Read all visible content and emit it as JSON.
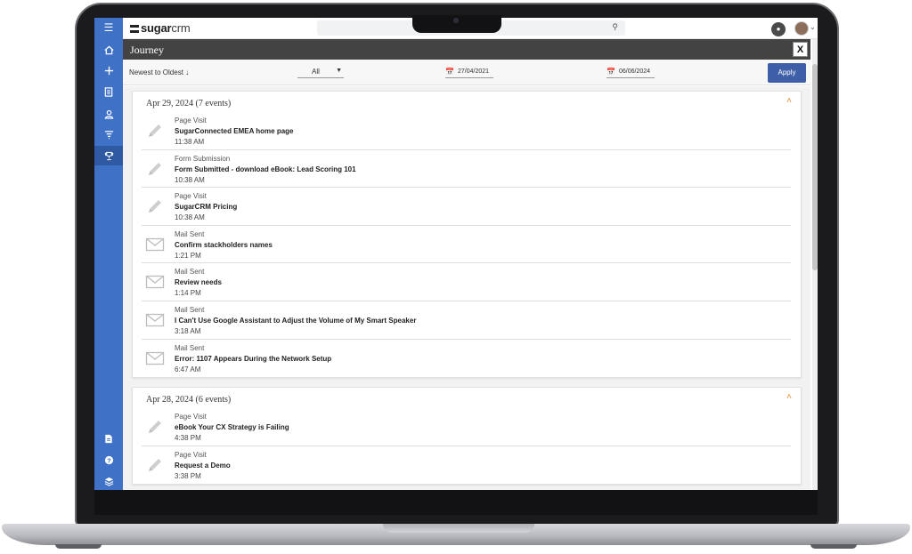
{
  "header": {
    "logo_bold": "sugar",
    "logo_light": "crm"
  },
  "dashlet": {
    "title": "Journey",
    "close_label": "X"
  },
  "filters": {
    "sort_label": "Newest to Oldest ↓",
    "type_value": "All",
    "date_from": "27/04/2021",
    "date_to": "06/06/2024",
    "apply_label": "Apply"
  },
  "sidebar": {
    "items": [
      "menu-icon",
      "home-icon",
      "plus-icon",
      "document-icon",
      "user-icon",
      "filter-icon",
      "trophy-icon"
    ],
    "bottom_items": [
      "file-icon",
      "help-icon",
      "stack-icon"
    ]
  },
  "groups": [
    {
      "title": "Apr 29, 2024 (7 events)",
      "events": [
        {
          "type": "Page Visit",
          "title": "SugarConnected EMEA home page",
          "time": "11:38 AM",
          "icon": "pencil-icon"
        },
        {
          "type": "Form Submission",
          "title": "Form Submitted - download eBook: Lead Scoring 101",
          "time": "10:38 AM",
          "icon": "pencil-icon"
        },
        {
          "type": "Page Visit",
          "title": "SugarCRM Pricing",
          "time": "10:38 AM",
          "icon": "pencil-icon"
        },
        {
          "type": "Mail Sent",
          "title": "Confirm stackholders names",
          "time": "1:21 PM",
          "icon": "mail-icon"
        },
        {
          "type": "Mail Sent",
          "title": "Review needs",
          "time": "1:14 PM",
          "icon": "mail-icon"
        },
        {
          "type": "Mail Sent",
          "title": "I Can't Use Google Assistant to Adjust the Volume of My Smart Speaker",
          "time": "3:18 AM",
          "icon": "mail-icon"
        },
        {
          "type": "Mail Sent",
          "title": "Error: 1107 Appears During the Network Setup",
          "time": "6:47 AM",
          "icon": "mail-icon"
        }
      ]
    },
    {
      "title": "Apr 28, 2024 (6 events)",
      "events": [
        {
          "type": "Page Visit",
          "title": "eBook Your CX Strategy is Failing",
          "time": "4:38 PM",
          "icon": "pencil-icon"
        },
        {
          "type": "Page Visit",
          "title": "Request a Demo",
          "time": "3:38 PM",
          "icon": "pencil-icon"
        }
      ]
    }
  ],
  "colors": {
    "sidebar": "#3f72c7",
    "title_bar": "#434343",
    "apply_button": "#3e5fa8",
    "caret_accent": "#e88a2c"
  }
}
